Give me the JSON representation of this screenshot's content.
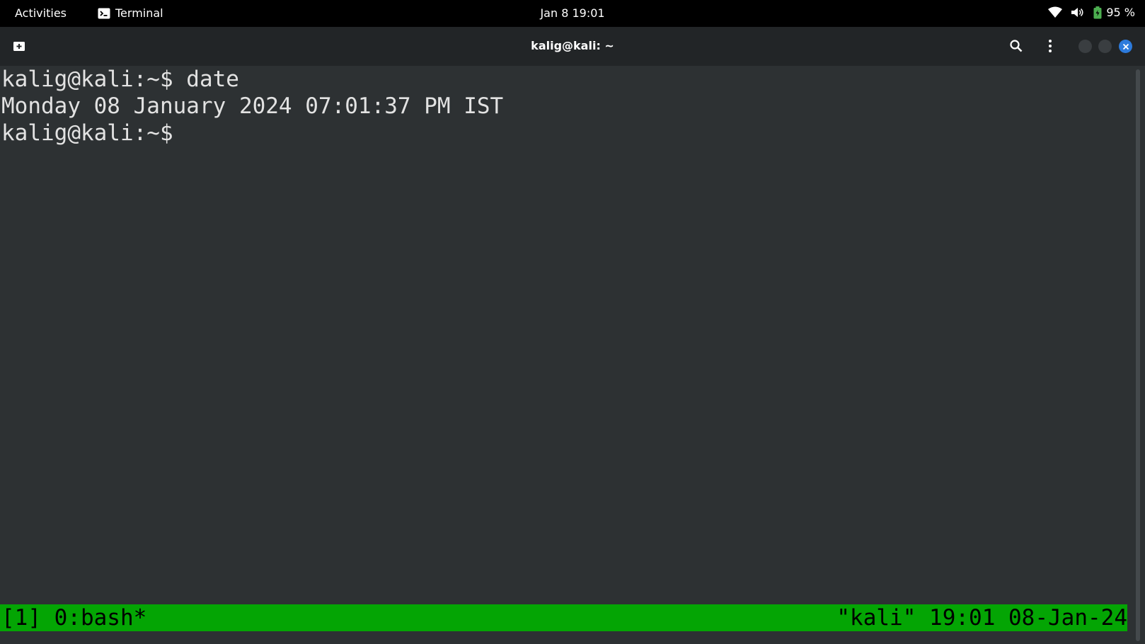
{
  "topbar": {
    "activities": "Activities",
    "app_name": "Terminal",
    "clock": "Jan 8  19:01",
    "battery": "95 %",
    "icons": [
      "terminal-app-icon",
      "wifi-icon",
      "volume-icon",
      "battery-icon"
    ]
  },
  "window": {
    "title": "kalig@kali: ~",
    "icons": [
      "new-tab-icon",
      "search-icon",
      "menu-icon",
      "close-icon"
    ]
  },
  "terminal": {
    "lines": [
      "kalig@kali:~$ date",
      "Monday 08 January 2024 07:01:37 PM IST",
      "kalig@kali:~$"
    ]
  },
  "tmux": {
    "left": "[1] 0:bash*",
    "right": "\"kali\" 19:01 08-Jan-24",
    "color": "#04a504"
  }
}
